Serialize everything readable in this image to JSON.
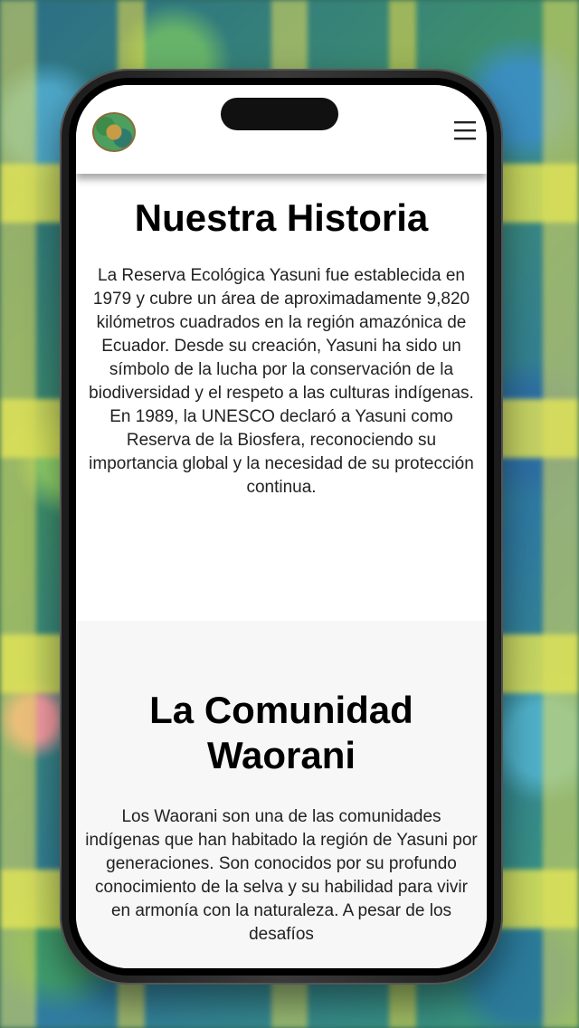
{
  "header": {
    "logo_name": "yasuni-logo",
    "menu_icon": "hamburger-menu-icon"
  },
  "history": {
    "title": "Nuestra Historia",
    "paragraph_1": "La Reserva Ecológica Yasuni fue establecida en 1979 y cubre un área de aproximadamente 9,820 kilómetros cuadrados en la región amazónica de Ecuador. Desde su creación, Yasuni ha sido un símbolo de la lucha por la conservación de la biodiversidad y el respeto a las culturas indígenas.",
    "paragraph_2": "En 1989, la UNESCO declaró a Yasuni como Reserva de la Biosfera, reconociendo su importancia global y la necesidad de su protección continua."
  },
  "waorani": {
    "title": "La Comunidad Waorani",
    "paragraph": "Los Waorani son una de las comunidades indígenas que han habitado la región de Yasuni por generaciones. Son conocidos por su profundo conocimiento de la selva y su habilidad para vivir en armonía con la naturaleza. A pesar de los desafíos"
  }
}
